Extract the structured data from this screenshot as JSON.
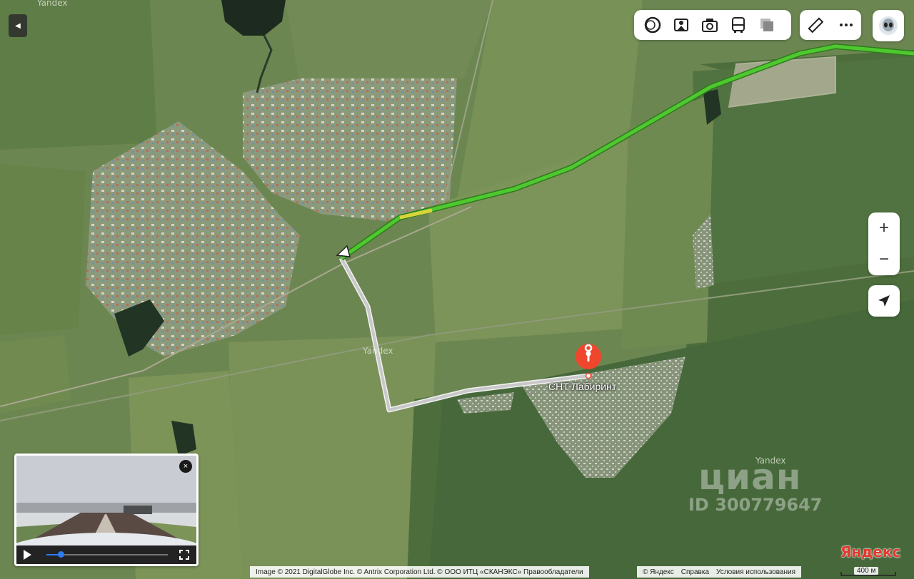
{
  "map": {
    "watermarks": [
      "Yandex",
      "Yandex",
      "Yandex"
    ],
    "destination_label": "СНТ Лабиринт",
    "zoom_in": "+",
    "zoom_out": "−"
  },
  "toolbar": {
    "buttons": [
      "layers-icon",
      "panorama-icon",
      "photos-icon",
      "transport-icon",
      "map-layers-icon"
    ],
    "tools": [
      "ruler-icon",
      "more-icon"
    ]
  },
  "video": {
    "close": "×",
    "progress": 0.12
  },
  "watermark": {
    "brand": "циан",
    "id": "ID 300779647"
  },
  "logo": "Яндекс",
  "copyright": {
    "main": "Image © 2021 DigitalGlobe Inc. © Antrix Corporation Ltd. © ООО ИТЦ «СКАНЭКС»  Правообладатели",
    "yandex": "© Яндекс",
    "help": "Справка",
    "terms": "Условия использования"
  },
  "scale": "400 м",
  "colors": {
    "route_green": "#4fc830",
    "route_slow": "#d8d43a",
    "route_walk": "#dadada",
    "pin": "#f0462e"
  }
}
